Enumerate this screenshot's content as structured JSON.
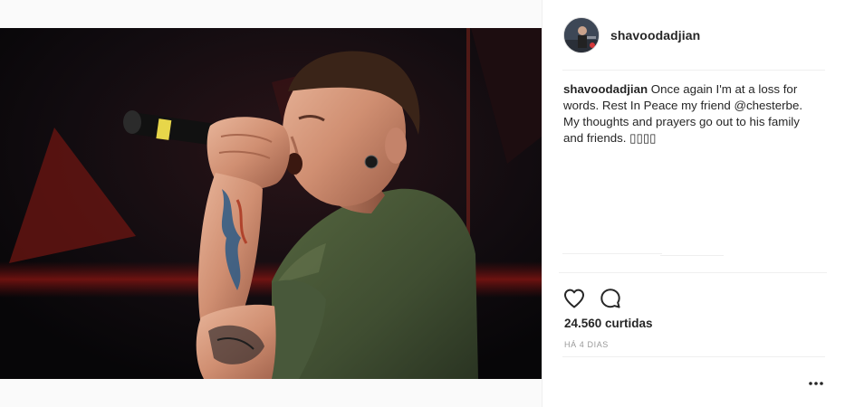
{
  "post": {
    "username": "shavoodadjian",
    "caption_text": " Once again I'm at a loss for words. Rest In Peace my friend @chesterbe. My thoughts and prayers go out to his family and friends. ▯▯▯▯",
    "likes": "24.560 curtidas",
    "timestamp": "HÁ 4 DIAS"
  },
  "icons": {
    "like": "heart-icon",
    "comment": "comment-bubble-icon",
    "more": "more-options-icon"
  },
  "colors": {
    "text": "#262626",
    "muted": "#999999",
    "divider": "#efefef",
    "photo_background": "#0d0d0f",
    "shirt": "#4a5a3c",
    "stage_light": "#c0261f"
  }
}
